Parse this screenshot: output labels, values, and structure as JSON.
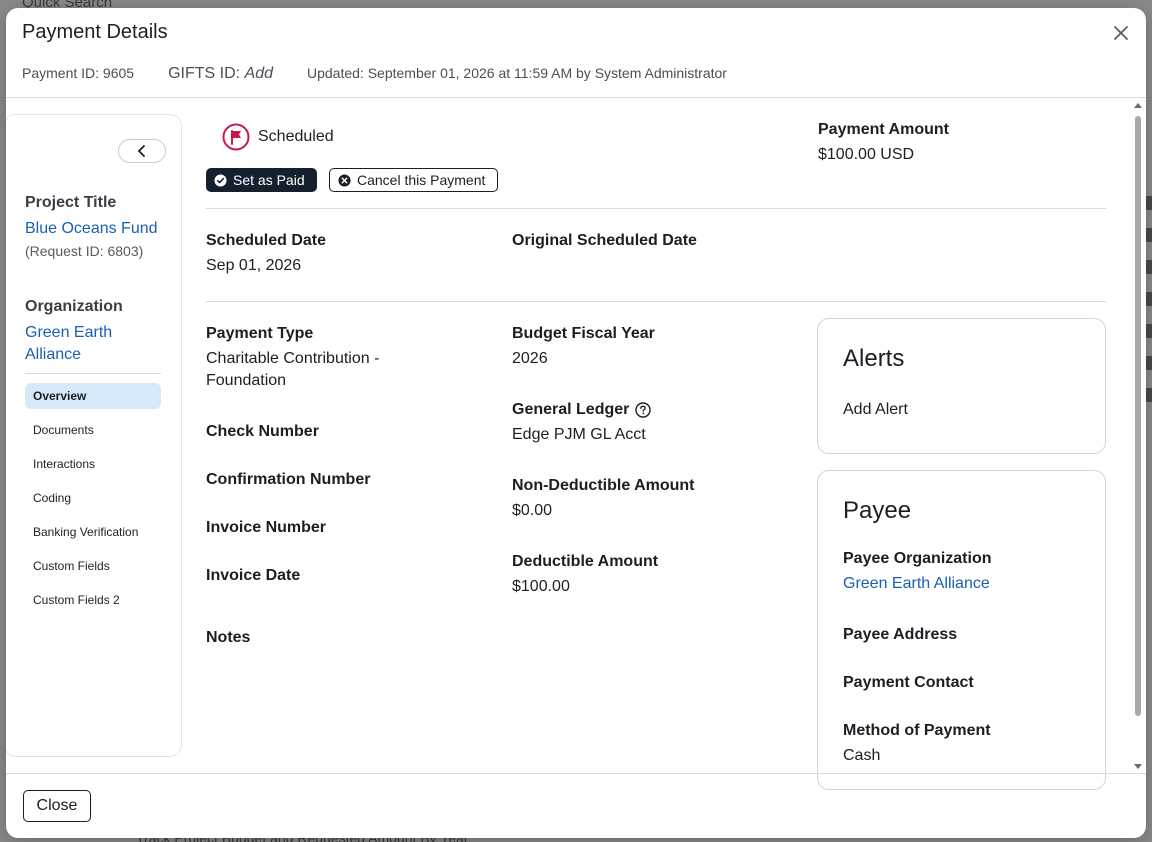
{
  "background": {
    "search_text": "Quick Search",
    "footer_text": "Track Project Budget and Requested Amount By Year"
  },
  "modal": {
    "title": "Payment Details",
    "payment_id": "Payment ID: 9605",
    "gifts_label": "GIFTS ID:",
    "gifts_add": "Add",
    "updated": "Updated: September 01, 2026 at 11:59 AM by System Administrator"
  },
  "sidebar": {
    "project_title_label": "Project Title",
    "project_link": "Blue Oceans Fund",
    "request_id": "(Request ID: 6803)",
    "organization_label": "Organization",
    "organization_link": "Green Earth Alliance",
    "nav": [
      "Overview",
      "Documents",
      "Interactions",
      "Coding",
      "Banking Verification",
      "Custom Fields",
      "Custom Fields 2"
    ]
  },
  "status": {
    "text": "Scheduled"
  },
  "actions": {
    "set_paid": "Set as Paid",
    "cancel": "Cancel this Payment"
  },
  "payment_amount": {
    "label": "Payment Amount",
    "value": "$100.00 USD"
  },
  "fields": {
    "scheduled_date_label": "Scheduled Date",
    "scheduled_date_value": "Sep 01, 2026",
    "original_scheduled_label": "Original Scheduled Date",
    "payment_type_label": "Payment Type",
    "payment_type_value": "Charitable Contribution - Foundation",
    "check_number_label": "Check Number",
    "confirmation_number_label": "Confirmation Number",
    "invoice_number_label": "Invoice Number",
    "invoice_date_label": "Invoice Date",
    "notes_label": "Notes",
    "budget_fy_label": "Budget Fiscal Year",
    "budget_fy_value": "2026",
    "general_ledger_label": "General Ledger",
    "general_ledger_value": "Edge PJM GL Acct",
    "non_deductible_label": "Non-Deductible Amount",
    "non_deductible_value": "$0.00",
    "deductible_label": "Deductible Amount",
    "deductible_value": "$100.00"
  },
  "alerts": {
    "title": "Alerts",
    "add": "Add Alert"
  },
  "payee": {
    "title": "Payee",
    "org_label": "Payee Organization",
    "org_value": "Green Earth Alliance",
    "address_label": "Payee Address",
    "contact_label": "Payment Contact",
    "method_label": "Method of Payment",
    "method_value": "Cash"
  },
  "footer": {
    "close": "Close"
  },
  "colors": {
    "accent": "#1a5fb4",
    "flag": "#c8184a",
    "dark_button": "#14202e",
    "nav_active": "#d6e9fb"
  }
}
